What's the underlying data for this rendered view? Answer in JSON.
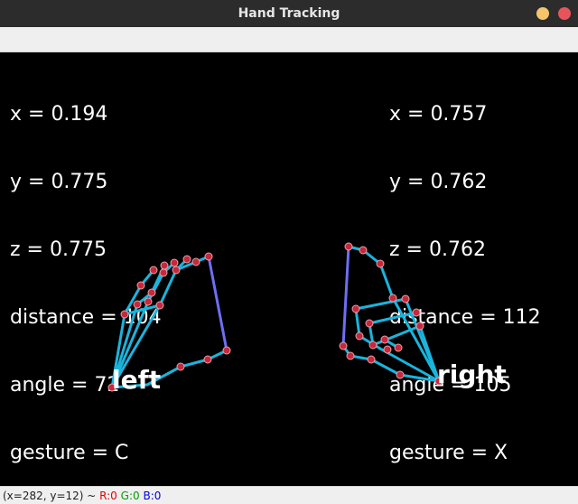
{
  "window": {
    "title": "Hand Tracking"
  },
  "left_info": {
    "x": "x = 0.194",
    "y": "y = 0.775",
    "z": "z = 0.775",
    "distance": "distance = 104",
    "angle": "angle = 72",
    "gesture": "gesture = C"
  },
  "right_info": {
    "x": "x = 0.757",
    "y": "y = 0.762",
    "z": "z = 0.762",
    "distance": "distance = 112",
    "angle": "angle = 105",
    "gesture": "gesture = X"
  },
  "hands": {
    "left_label": "left",
    "right_label": "right"
  },
  "status": {
    "coords": "(x=282, y=12) ~ ",
    "r": "R:0",
    "g": "G:0",
    "b": "B:0"
  },
  "colors": {
    "bone": "#1ab4dc",
    "bone_highlight": "#6e6ef5",
    "joint": "#c8283c"
  }
}
